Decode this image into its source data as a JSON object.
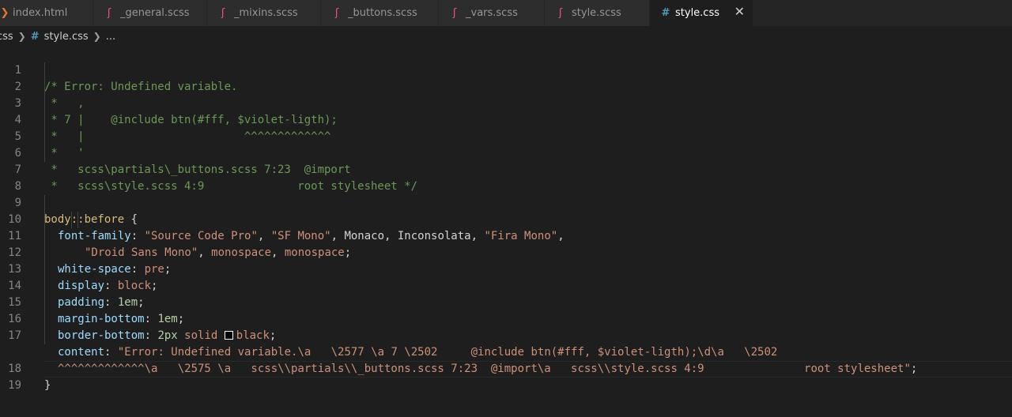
{
  "tabs": [
    {
      "label": "index.html",
      "icon": "html-icon",
      "icon_glyph": "❯",
      "color": "#e37933",
      "active": false
    },
    {
      "label": "_general.scss",
      "icon": "sass-icon",
      "icon_glyph": "ʃ",
      "color": "#f55385",
      "active": false
    },
    {
      "label": "_mixins.scss",
      "icon": "sass-icon",
      "icon_glyph": "ʃ",
      "color": "#f55385",
      "active": false
    },
    {
      "label": "_buttons.scss",
      "icon": "sass-icon",
      "icon_glyph": "ʃ",
      "color": "#f55385",
      "active": false
    },
    {
      "label": "_vars.scss",
      "icon": "sass-icon",
      "icon_glyph": "ʃ",
      "color": "#f55385",
      "active": false
    },
    {
      "label": "style.scss",
      "icon": "sass-icon",
      "icon_glyph": "ʃ",
      "color": "#f55385",
      "active": false
    },
    {
      "label": "style.css",
      "icon": "css-icon",
      "icon_glyph": "#",
      "color": "#519aba",
      "active": true
    }
  ],
  "close_glyph": "✕",
  "breadcrumb": {
    "folder": "css",
    "file": "style.css",
    "symbol": "..."
  },
  "line_numbers": [
    "1",
    "2",
    "3",
    "4",
    "5",
    "6",
    "7",
    "8",
    "9",
    "10",
    "11",
    "12",
    "13",
    "14",
    "15",
    "16",
    "17",
    "",
    "18",
    "19"
  ],
  "code": {
    "l1": "/* Error: Undefined variable.",
    "l2": " *   ,",
    "l3": " * 7 |    @include btn(#fff, $violet-ligth);",
    "l4": " *   |                        ^^^^^^^^^^^^^",
    "l5": " *   '",
    "l6": " *   scss\\partials\\_buttons.scss 7:23  @import",
    "l7": " *   scss\\style.scss 4:9              root stylesheet */",
    "l9_sel": "body::before",
    "l9_brace": " {",
    "l10_prop": "font-family",
    "l10_a": ": ",
    "l10_s1": "\"Source Code Pro\"",
    "l10_c1": ", ",
    "l10_s2": "\"SF Mono\"",
    "l10_c2": ", Monaco, Inconsolata, ",
    "l10_s3": "\"Fira Mono\"",
    "l10_c3": ",",
    "l11_s1": "\"Droid Sans Mono\"",
    "l11_c1": ", ",
    "l11_v1": "monospace",
    "l11_c2": ", ",
    "l11_v2": "monospace",
    "l11_c3": ";",
    "l12_prop": "white-space",
    "l12_val": "pre",
    "l13_prop": "display",
    "l13_val": "block",
    "l14_prop": "padding",
    "l14_val": "1em",
    "l15_prop": "margin-bottom",
    "l15_val": "1em",
    "l16_prop": "border-bottom",
    "l16_num": "2px",
    "l16_solid": "solid",
    "l16_color": "black",
    "l17_prop": "content",
    "l17_str": "\"Error: Undefined variable.\\a   \\2577 \\a 7 \\2502     @include btn(#fff, $violet-ligth);\\d\\a   \\2502",
    "l17b_str": "^^^^^^^^^^^^^\\a   \\2575 \\a   scss\\\\partials\\\\_buttons.scss 7:23  @import\\a   scss\\\\style.scss 4:9               root stylesheet\"",
    "l17b_end": ";",
    "l18": "}",
    "colon": ": ",
    "semi": ";"
  }
}
